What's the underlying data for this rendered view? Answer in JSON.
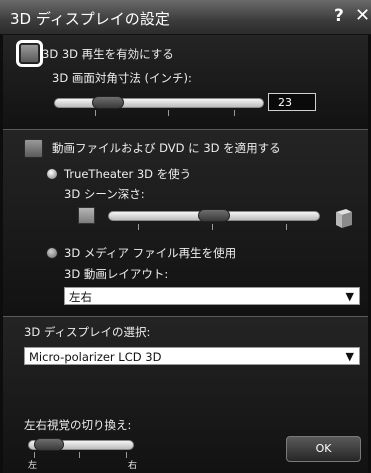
{
  "window": {
    "title": "3D ディスプレイの設定",
    "help_label": "?",
    "close_label": "✕"
  },
  "stereo": {
    "enable_label": "3D 3D 再生を有効にする",
    "enabled": false,
    "size_label": "3D 画面対角寸法 (インチ):",
    "size_value": "23"
  },
  "video": {
    "apply_label": "動画ファイルおよび DVD に 3D を適用する",
    "truetheater_label": "TrueTheater 3D を使う",
    "depth_label": "3D シーン深さ:",
    "media_label": "3D メディア ファイル再生を使用",
    "layout_label": "3D 動画レイアウト:",
    "layout_value": "左右"
  },
  "display": {
    "select_label": "3D ディスプレイの選択:",
    "select_value": "Micro-polarizer LCD 3D"
  },
  "swap": {
    "label": "左右視覚の切り換え:",
    "left_label": "左",
    "right_label": "右"
  },
  "buttons": {
    "ok_label": "OK"
  },
  "icons": {
    "dropdown_arrow": "▼"
  }
}
